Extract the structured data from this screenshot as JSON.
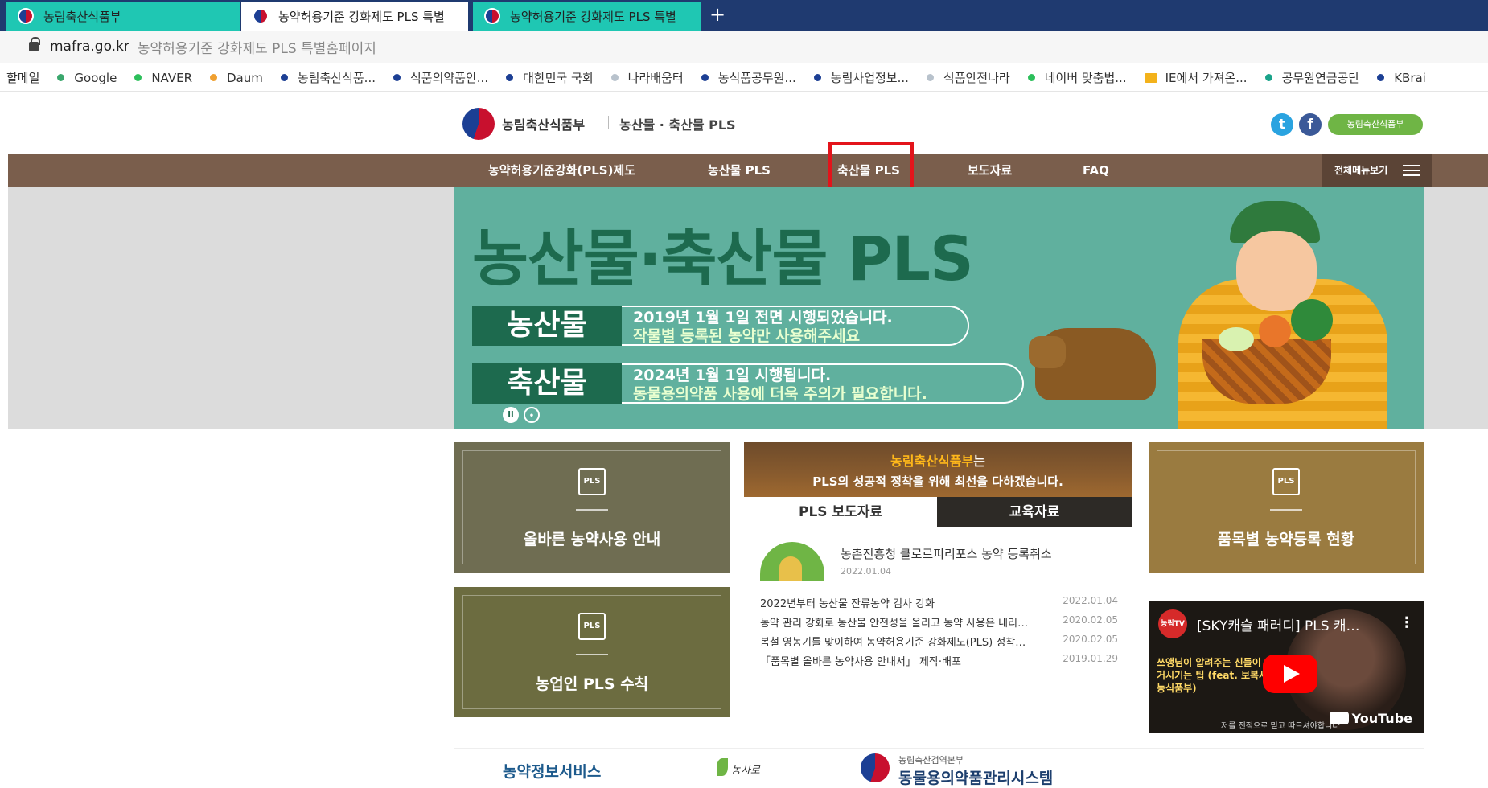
{
  "browser": {
    "tabs": [
      {
        "label": "농림축산식품부"
      },
      {
        "label": "농약허용기준 강화제도 PLS 특별"
      },
      {
        "label": "농약허용기준 강화제도 PLS 특별"
      }
    ],
    "new_tab": "+",
    "address": {
      "domain": "mafra.go.kr",
      "title": "농약허용기준 강화제도 PLS 특별홈페이지"
    },
    "bookmarks": [
      {
        "label": "Google",
        "color": "#3aa76d"
      },
      {
        "label": "NAVER",
        "color": "#2cbf5b"
      },
      {
        "label": "Daum",
        "color": "#f0a030"
      },
      {
        "label": "농림축산식품...",
        "color": "#1c3f94"
      },
      {
        "label": "식품의약품안...",
        "color": "#1c3f94"
      },
      {
        "label": "대한민국 국회",
        "color": "#1c3f94"
      },
      {
        "label": "나라배움터",
        "color": "#b8c2cc"
      },
      {
        "label": "농식품공무원...",
        "color": "#1c3f94"
      },
      {
        "label": "농림사업정보...",
        "color": "#1c3f94"
      },
      {
        "label": "식품안전나라",
        "color": "#b8c2cc"
      },
      {
        "label": "네이버 맞춤법...",
        "color": "#2cbf5b"
      },
      {
        "label": "IE에서 가져온...",
        "color": "folder"
      },
      {
        "label": "공무원연금공단",
        "color": "#1aa38a"
      },
      {
        "label": "KBrai",
        "color": "#1c3f94"
      }
    ],
    "bookmark_first": "할메일"
  },
  "site": {
    "org": "농림축산식품부",
    "sub": "농산물 · 축산물 PLS",
    "sns_t": "t",
    "sns_f": "f",
    "pill": "농림축산식품부"
  },
  "nav": {
    "items": [
      "농약허용기준강화(PLS)제도",
      "농산물 PLS",
      "축산물 PLS",
      "보도자료",
      "FAQ"
    ],
    "all_menu": "전체메뉴보기"
  },
  "hero": {
    "title": "농산물·축산물 PLS",
    "rows": [
      {
        "tag": "농산물",
        "line1": "2019년 1월 1일 전면 시행되었습니다.",
        "line2": "작물별 등록된 농약만 사용해주세요"
      },
      {
        "tag": "축산물",
        "line1": "2024년 1월 1일 시행됩니다.",
        "line2": "동물용의약품 사용에 더욱 주의가 필요합니다."
      }
    ],
    "pause": "II",
    "next": "•"
  },
  "cards": {
    "a": {
      "icon": "PLS",
      "label": "올바른 농약사용 안내"
    },
    "b": {
      "icon": "PLS",
      "label": "농업인 PLS 수칙"
    },
    "c": {
      "icon": "PLS",
      "label": "품목별 농약등록 현황"
    }
  },
  "center": {
    "highlight": "농림축산식품부",
    "line1_suffix": "는",
    "line2": "PLS의 성공적 정착을 위해 최선을 다하겠습니다.",
    "tab_a": "PLS 보도자료",
    "tab_b": "교육자료",
    "head": {
      "title": "농촌진흥청 클로르피리포스 농약 등록취소",
      "date": "2022.01.04"
    },
    "rows": [
      {
        "title": "2022년부터 농산물 잔류농약 검사 강화",
        "date": "2022.01.04"
      },
      {
        "title": "농약 관리 강화로 농산물 안전성을 올리고 농약 사용은 내리…",
        "date": "2020.02.05"
      },
      {
        "title": "봄철 영농기를 맞이하여 농약허용기준 강화제도(PLS) 정착…",
        "date": "2020.02.05"
      },
      {
        "title": "「품목별 올바른 농약사용 안내서」 제작·배포",
        "date": "2019.01.29"
      }
    ]
  },
  "video": {
    "channel": "농림TV",
    "title": "[SKY캐슬 패러디] PLS 캐…",
    "menu": "⋮",
    "side": "쓰앵님이 알려주는 신들이 한거시기는 팁 (feat. 보복사는 농식품부)",
    "caption": "저를 전적으로 믿고 따르셔야합니다",
    "brand": "YouTube"
  },
  "banners": {
    "b1": "농약정보서비스",
    "b2": "농사로",
    "b3_sub": "농림축산검역본부",
    "b3_main": "동물용의약품관리시스템"
  }
}
